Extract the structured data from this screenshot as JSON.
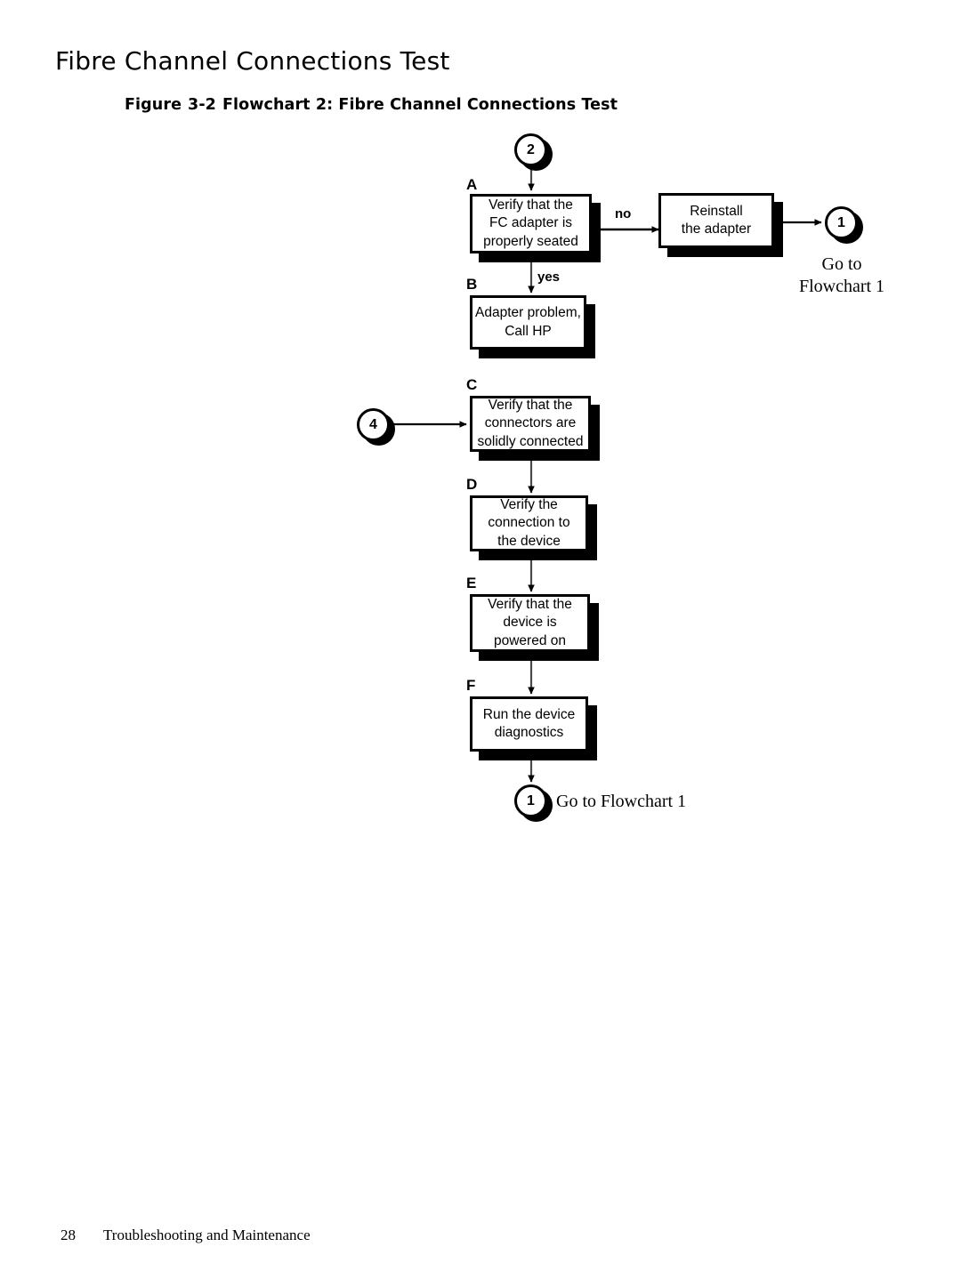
{
  "page": {
    "title": "Fibre Channel Connections Test",
    "figure_caption": {
      "label": "Figure",
      "number": "3-2",
      "text": "Flowchart 2: Fibre Channel Connections Test"
    },
    "footer": {
      "page_number": "28",
      "section": "Troubleshooting and Maintenance"
    }
  },
  "flowchart": {
    "entry_connector": {
      "id": "2",
      "label": "2"
    },
    "nodes": [
      {
        "step": "A",
        "text": "Verify that the\nFC adapter is\nproperly seated"
      },
      {
        "step": "",
        "text": "Reinstall\nthe adapter"
      },
      {
        "step": "B",
        "text": "Adapter problem,\nCall HP"
      },
      {
        "step": "C",
        "text": "Verify that the\nconnectors are\nsolidly connected"
      },
      {
        "step": "D",
        "text": "Verify the\nconnection to\nthe device"
      },
      {
        "step": "E",
        "text": "Verify that the\ndevice is\npowered on"
      },
      {
        "step": "F",
        "text": "Run the device\ndiagnostics"
      }
    ],
    "branch_labels": {
      "no": "no",
      "yes": "yes"
    },
    "connectors": [
      {
        "id": "1-top",
        "label": "1",
        "caption": "Go to\nFlowchart 1"
      },
      {
        "id": "4-left",
        "label": "4",
        "caption": ""
      },
      {
        "id": "1-bottom",
        "label": "1",
        "caption": "Go to Flowchart 1"
      }
    ],
    "goto_top": {
      "line1": "Go to",
      "line2": "Flowchart 1"
    },
    "goto_bottom": {
      "text": "Go to Flowchart 1"
    },
    "colors": {
      "stroke": "#000000",
      "fill": "#ffffff",
      "shadow": "#000000"
    }
  }
}
